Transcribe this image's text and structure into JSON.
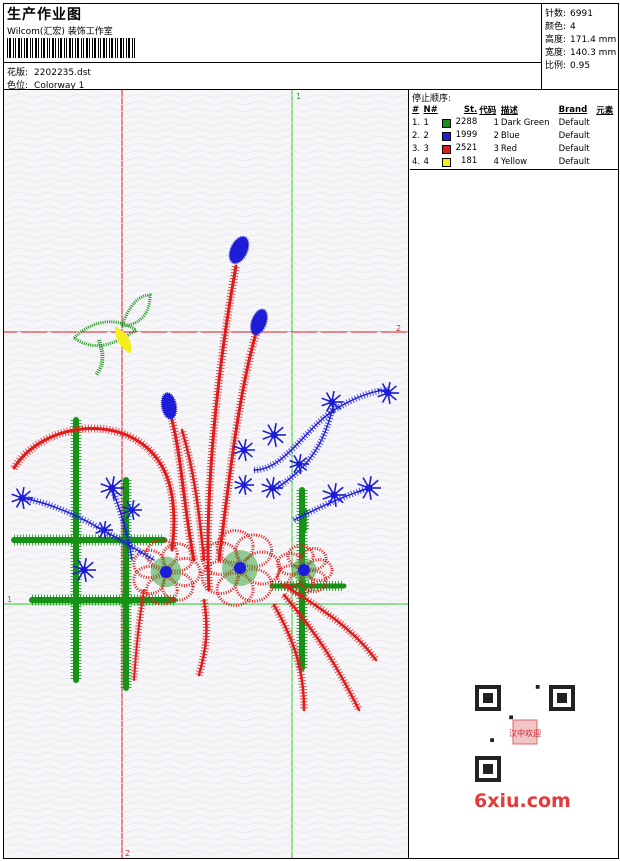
{
  "header": {
    "title": "生产作业图",
    "company": "Wilcom(汇宏) 装饰工作室",
    "design_label": "花版:",
    "design_file": "2202235.dst",
    "colorway_label": "色位:",
    "colorway": "Colorway 1"
  },
  "stats": [
    {
      "label": "针数:",
      "value": "6991"
    },
    {
      "label": "颜色:",
      "value": "4"
    },
    {
      "label": "高度:",
      "value": "171.4 mm"
    },
    {
      "label": "宽度:",
      "value": "140.3 mm"
    },
    {
      "label": "比例:",
      "value": "0.95"
    }
  ],
  "guides": {
    "label_top": "1",
    "label_right": "2",
    "label_bottom": "2",
    "label_left": "1"
  },
  "stop_sequence": {
    "title": "停止顺序:",
    "columns": [
      "#",
      "N#",
      "St.",
      "代码",
      "描述",
      "Brand",
      "元素"
    ],
    "rows": [
      {
        "idx": "1.",
        "n": "1",
        "stitches": "2288",
        "code": "1",
        "desc": "Dark Green",
        "brand": "Default",
        "color": "#169316"
      },
      {
        "idx": "2.",
        "n": "2",
        "stitches": "1999",
        "code": "2",
        "desc": "Blue",
        "brand": "Default",
        "color": "#1c1cd9"
      },
      {
        "idx": "3.",
        "n": "3",
        "stitches": "2521",
        "code": "3",
        "desc": "Red",
        "brand": "Default",
        "color": "#e01c1c"
      },
      {
        "idx": "4.",
        "n": "4",
        "stitches": "181",
        "code": "4",
        "desc": "Yellow",
        "brand": "Default",
        "color": "#f2ef1a"
      }
    ]
  },
  "watermark": {
    "site": "6xiu.com",
    "stamp": "汉中欢迎"
  },
  "colors": {
    "green": "#169316",
    "blue": "#1c1cd9",
    "red": "#e01c1c",
    "yellow": "#f2ef1a",
    "guide_red": "#d01818",
    "guide_green": "#28c828"
  }
}
